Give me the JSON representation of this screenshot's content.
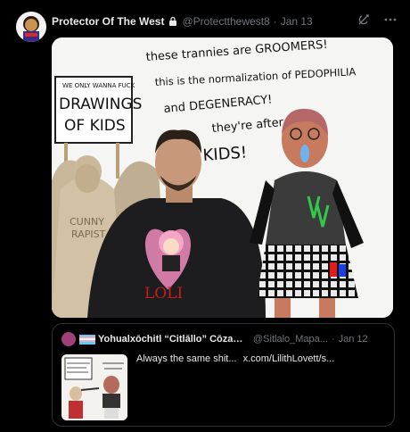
{
  "tweet": {
    "author_name": "Protector Of The West",
    "author_handle": "@Protectthewest8",
    "separator": "·",
    "date": "Jan 13",
    "icons": [
      "avatar",
      "lock-icon",
      "grok-icon",
      "more-icon"
    ]
  },
  "media": {
    "handwritten_lines": [
      "these trannies are GROOMERS!",
      "this is the normalization of PEDOPHILIA",
      "and DEGENERACY!",
      "they're after",
      "KIDS!"
    ],
    "sign_text": [
      "WE ONLY WANNA FUCK",
      "DRAWINGS",
      "OF KIDS"
    ],
    "shirt_text": [
      "CUNNY",
      "RAPIST"
    ],
    "loli_label": "LOLI"
  },
  "quote": {
    "author_name": "Yohualxōchitl “Citlāllo” Cōzamālōtl...",
    "author_handle": "@Sitlalo_Mapa...",
    "separator": "·",
    "date": "Jan 12",
    "text": "Always the same shit...",
    "link": "x.com/LilithLovett/s..."
  },
  "colors": {
    "background": "#000000",
    "text_primary": "#e7e9ea",
    "text_secondary": "#71767b",
    "border": "#2f3336"
  }
}
